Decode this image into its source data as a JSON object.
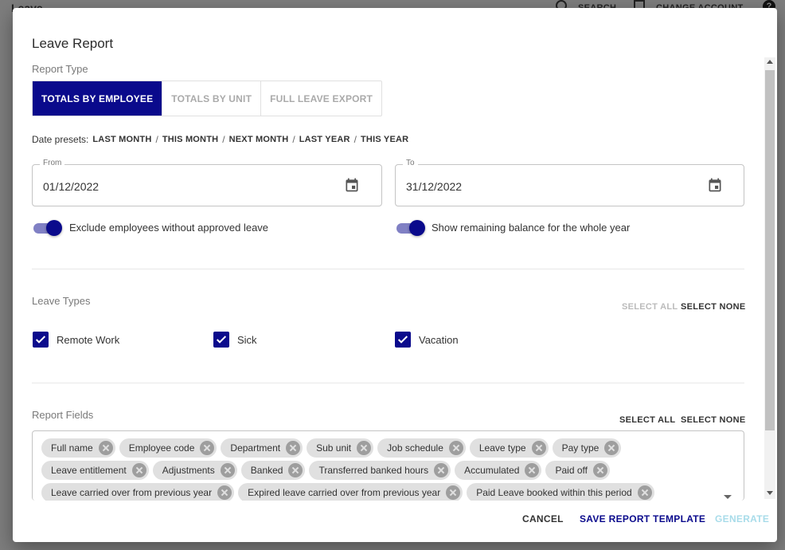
{
  "background": {
    "logo": "Leave",
    "search": "SEARCH",
    "change_account": "CHANGE ACCOUNT",
    "help": "?"
  },
  "dialog": {
    "title": "Leave Report",
    "report_type": {
      "label": "Report Type",
      "options": [
        "TOTALS BY EMPLOYEE",
        "TOTALS BY UNIT",
        "FULL LEAVE EXPORT"
      ],
      "selected": "TOTALS BY EMPLOYEE"
    },
    "date_presets": {
      "label": "Date presets:",
      "items": [
        "LAST MONTH",
        "THIS MONTH",
        "NEXT MONTH",
        "LAST YEAR",
        "THIS YEAR"
      ],
      "separator": "/"
    },
    "from": {
      "label": "From",
      "value": "01/12/2022"
    },
    "to": {
      "label": "To",
      "value": "31/12/2022"
    },
    "toggles": {
      "exclude": {
        "label": "Exclude employees without approved leave",
        "on": true
      },
      "remaining": {
        "label": "Show remaining balance for the whole year",
        "on": true
      }
    },
    "leave_types": {
      "label": "Leave Types",
      "select_all": "SELECT ALL",
      "select_none": "SELECT NONE",
      "items": [
        {
          "label": "Remote Work",
          "checked": true
        },
        {
          "label": "Sick",
          "checked": true
        },
        {
          "label": "Vacation",
          "checked": true
        }
      ]
    },
    "report_fields": {
      "label": "Report Fields",
      "select_all": "SELECT ALL",
      "select_none": "SELECT NONE",
      "chips_row1": [
        "Full name",
        "Employee code",
        "Department",
        "Sub unit",
        "Job schedule",
        "Leave type",
        "Pay type"
      ],
      "chips_row2": [
        "Leave entitlement",
        "Adjustments",
        "Banked",
        "Transferred banked hours",
        "Accumulated",
        "Paid off"
      ],
      "chips_row3": [
        "Leave carried over from previous year",
        "Expired leave carried over from previous year",
        "Paid Leave booked within this period"
      ]
    },
    "actions": {
      "cancel": "CANCEL",
      "save_template": "SAVE REPORT TEMPLATE",
      "generate": "GENERATE"
    }
  },
  "colors": {
    "primary": "#0a0a8c",
    "toggle_track": "#8080c4",
    "chip_bg": "#e0e0e0",
    "generate_disabled": "#a8dcea"
  }
}
